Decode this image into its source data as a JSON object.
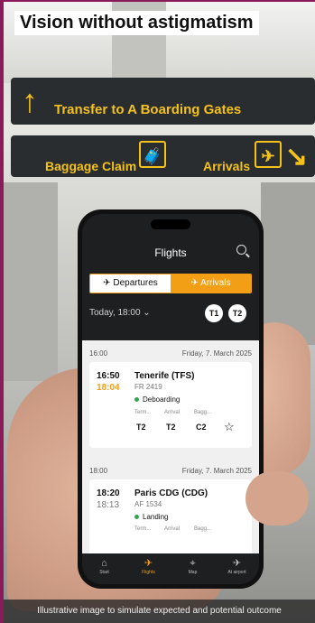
{
  "title": "Vision without astigmatism",
  "signs": {
    "transfer": "Transfer to A Boarding Gates",
    "baggage": "Baggage Claim",
    "arrivals": "Arrivals"
  },
  "app": {
    "header_title": "Flights",
    "toggle": {
      "departures": "Departures",
      "arrivals": "Arrivals"
    },
    "date_filter": "Today, 18:00",
    "terminals": [
      "T1",
      "T2"
    ],
    "groups": [
      {
        "time": "16:00",
        "date": "Friday, 7. March 2025",
        "flight": {
          "scheduled": "16:50",
          "actual": "18:04",
          "destination": "Tenerife (TFS)",
          "number": "FR 2419",
          "status": "Deboarding",
          "labels": [
            "Term...",
            "Arrival",
            "Bagg..."
          ],
          "values": [
            "T2",
            "T2",
            "C2"
          ]
        }
      },
      {
        "time": "18:00",
        "date": "Friday, 7. March 2025",
        "flight": {
          "scheduled": "18:20",
          "actual": "18:13",
          "destination": "Paris CDG (CDG)",
          "number": "AF 1534",
          "status": "Landing",
          "labels": [
            "Term...",
            "Arrival",
            "Bagg..."
          ]
        }
      }
    ],
    "nav": [
      "Start",
      "Flights",
      "Map",
      "At airport"
    ]
  },
  "caption": "Illustrative image to simulate expected and potential outcome",
  "colors": {
    "accent": "#f29f16",
    "sign_text": "#f4c21b",
    "status_green": "#2fa84f",
    "border": "#8b1a5a"
  }
}
